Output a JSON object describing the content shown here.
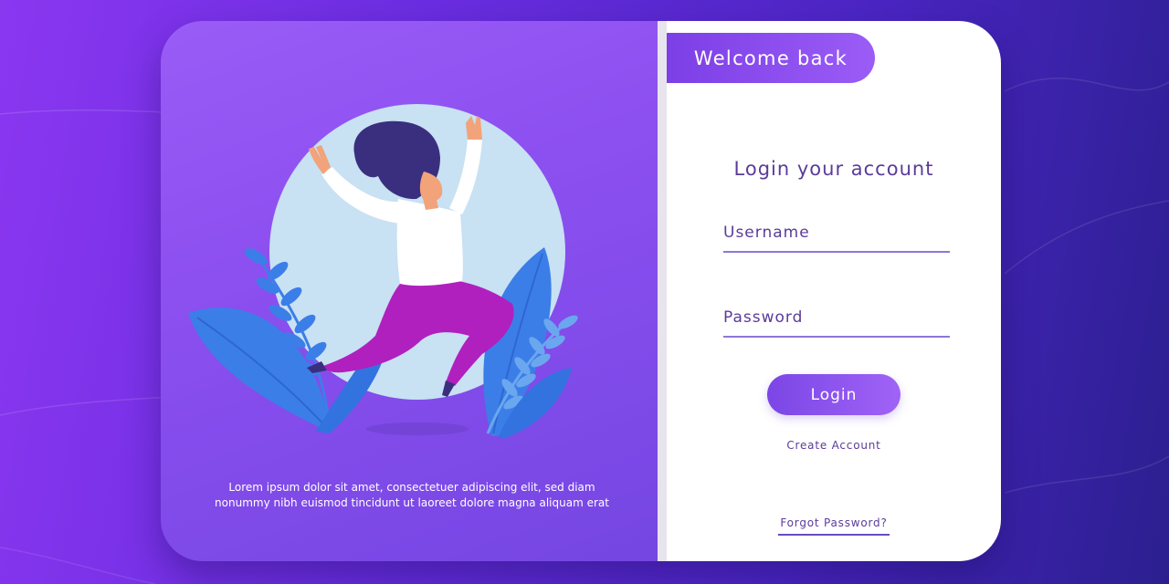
{
  "colors": {
    "background_start": "#8a37f0",
    "background_end": "#2b1f8f",
    "panel_purple": "#8c4ff0",
    "accent": "#9b5cf6",
    "text_purple": "#5b3b9a",
    "moon": "#c8e1f3",
    "plant_blue": "#3b7ee8",
    "pants_magenta": "#b020bf",
    "hair_navy": "#3a2f7e"
  },
  "left_panel": {
    "illustration": "woman-jumping-with-plants",
    "caption_line1": "Lorem ipsum dolor sit amet, consectetuer adipiscing elit, sed diam",
    "caption_line2": "nonummy nibh euismod tincidunt ut laoreet dolore magna aliquam erat"
  },
  "right_panel": {
    "welcome": "Welcome back",
    "title": "Login your account",
    "username_placeholder": "Username",
    "password_placeholder": "Password",
    "login_label": "Login",
    "create_account": "Create Account",
    "forgot_password": "Forgot Password?"
  }
}
